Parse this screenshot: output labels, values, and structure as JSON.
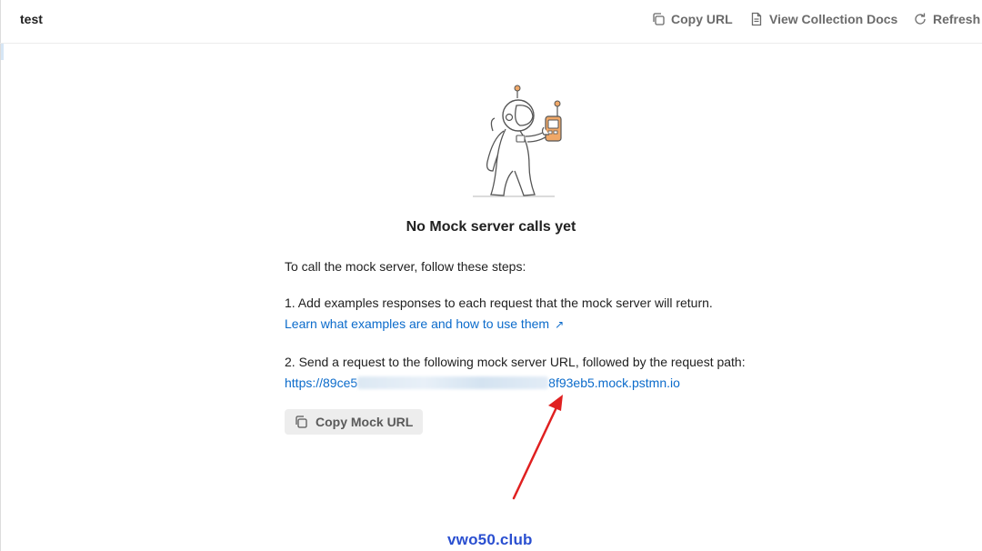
{
  "header": {
    "title": "test",
    "actions": [
      {
        "label": "Copy URL",
        "icon": "copy-icon"
      },
      {
        "label": "View Collection Docs",
        "icon": "document-icon"
      },
      {
        "label": "Refresh",
        "icon": "refresh-icon"
      }
    ]
  },
  "empty_state": {
    "illustration": "astronaut-with-walkie-talkie",
    "title": "No Mock server calls yet",
    "intro": "To call the mock server, follow these steps:",
    "step1": "1. Add examples responses to each request that the mock server will return.",
    "step1_link": "Learn what examples are and how to use them",
    "step1_link_icon": "↗",
    "step2": "2. Send a request to the following mock server URL, followed by the request path:",
    "url_start": "https://89ce5",
    "url_end": "8f93eb5.mock.pstmn.io",
    "copy_button": "Copy Mock URL"
  },
  "colors": {
    "link": "#0b6bcb",
    "accent_orange": "#f0a868",
    "annotation_arrow": "#e02020",
    "watermark": "#2a4fd0"
  },
  "watermark": "vwo50.club"
}
